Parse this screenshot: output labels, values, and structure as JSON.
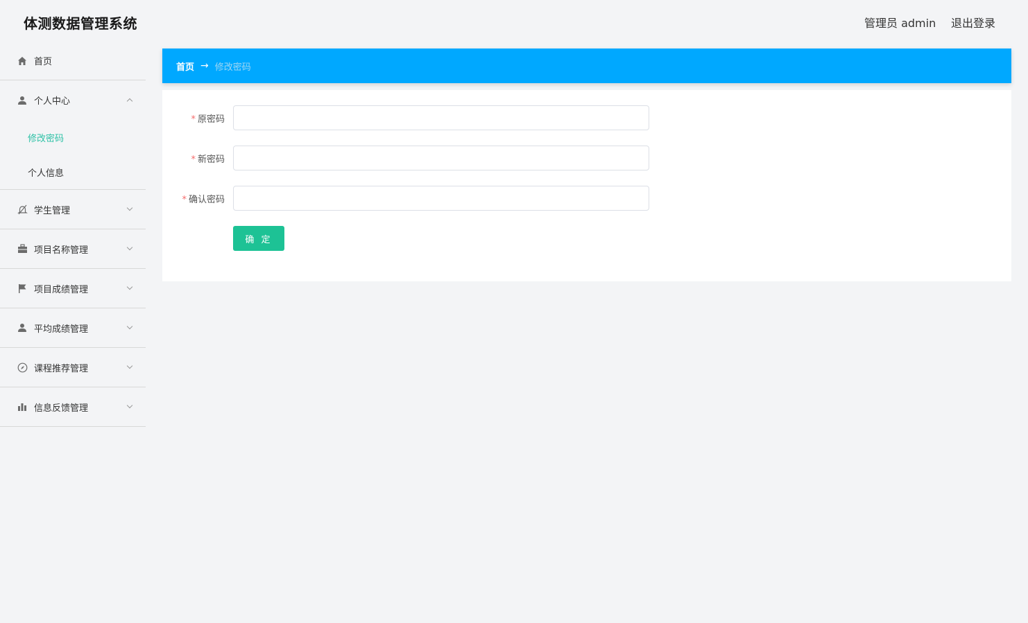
{
  "header": {
    "app_title": "体测数据管理系统",
    "user_label": "管理员 admin",
    "logout_label": "退出登录"
  },
  "sidebar": {
    "home": {
      "label": "首页",
      "icon": "home-icon"
    },
    "personal_center": {
      "label": "个人中心",
      "icon": "user-icon",
      "expanded": true,
      "children": [
        {
          "label": "修改密码",
          "active": true
        },
        {
          "label": "个人信息",
          "active": false
        }
      ]
    },
    "groups": [
      {
        "label": "学生管理",
        "icon": "bell-off-icon"
      },
      {
        "label": "项目名称管理",
        "icon": "briefcase-icon"
      },
      {
        "label": "项目成绩管理",
        "icon": "flag-icon"
      },
      {
        "label": "平均成绩管理",
        "icon": "user-icon"
      },
      {
        "label": "课程推荐管理",
        "icon": "compass-icon"
      },
      {
        "label": "信息反馈管理",
        "icon": "bar-chart-icon"
      }
    ]
  },
  "breadcrumb": {
    "home": "首页",
    "separator": "→",
    "current": "修改密码"
  },
  "form": {
    "fields": [
      {
        "label": "原密码",
        "required": true,
        "value": ""
      },
      {
        "label": "新密码",
        "required": true,
        "value": ""
      },
      {
        "label": "确认密码",
        "required": true,
        "value": ""
      }
    ],
    "submit_label": "确 定"
  },
  "colors": {
    "accent": "#00a8ff",
    "active_menu": "#2ec1a6",
    "submit": "#1dc295",
    "required": "#f56c6c"
  }
}
